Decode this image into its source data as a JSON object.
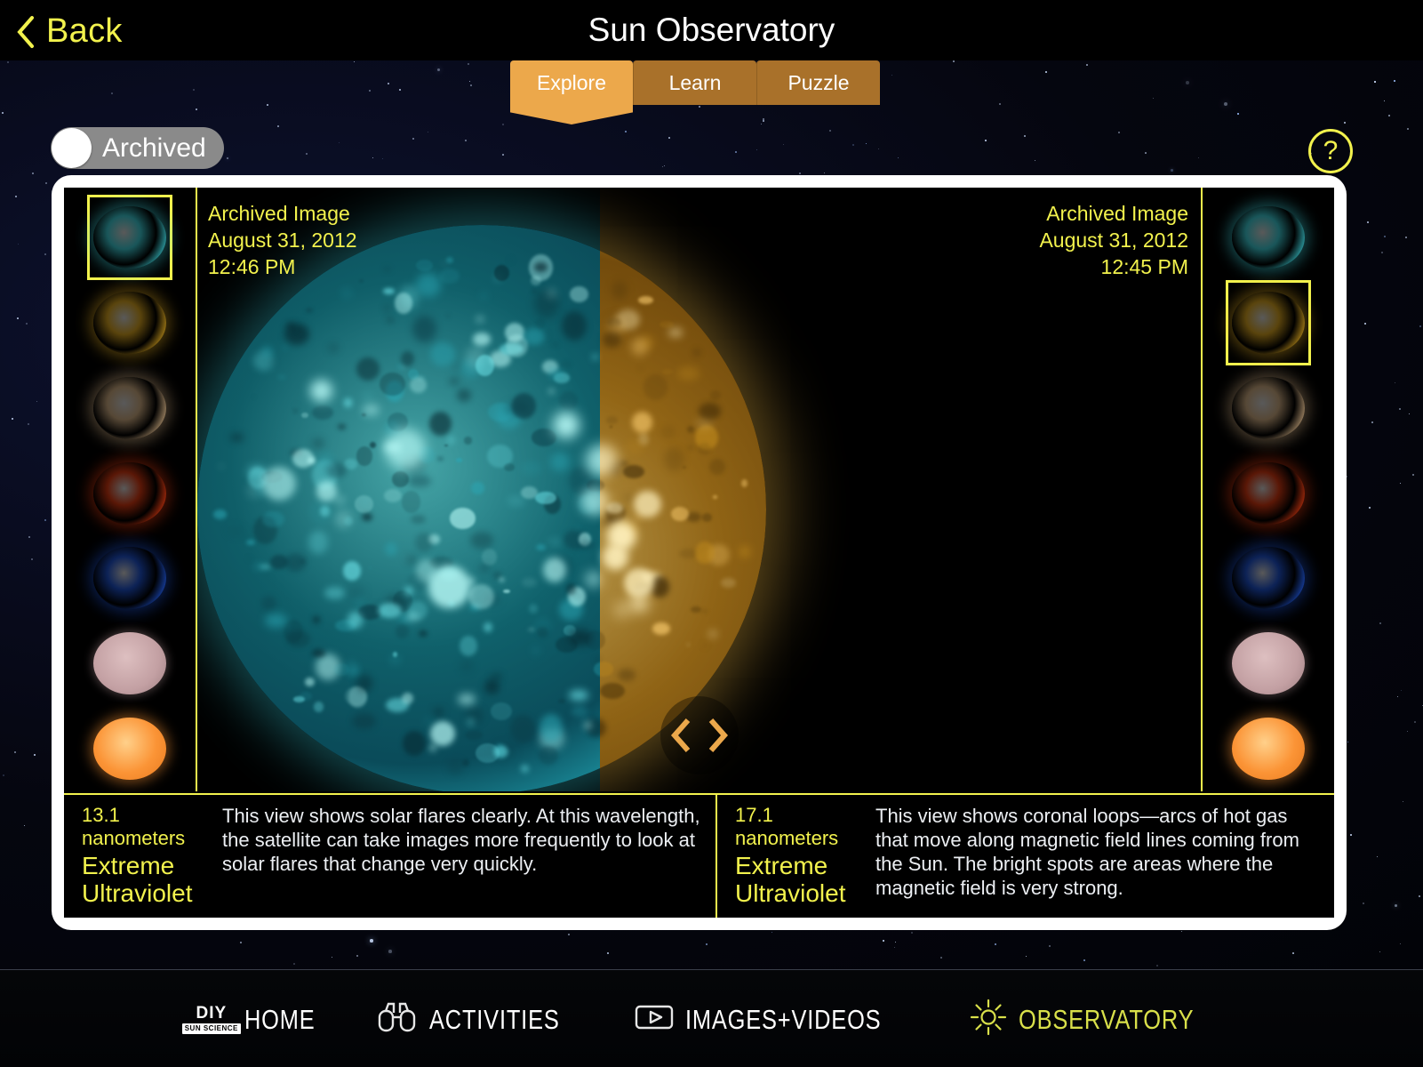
{
  "header": {
    "back_label": "Back",
    "back_icon": "chevron-left-icon",
    "title": "Sun Observatory"
  },
  "tabs": [
    {
      "label": "Explore",
      "active": true
    },
    {
      "label": "Learn",
      "active": false
    },
    {
      "label": "Puzzle",
      "active": false
    }
  ],
  "toggle": {
    "label": "Archived",
    "state": "off"
  },
  "help": {
    "label": "?",
    "icon": "question-mark-icon"
  },
  "viewer": {
    "left": {
      "meta_line1": "Archived Image",
      "meta_line2": "August 31, 2012",
      "meta_line3": "12:46 PM"
    },
    "right": {
      "meta_line1": "Archived Image",
      "meta_line2": "August 31, 2012",
      "meta_line3": "12:45 PM"
    },
    "prev_icon": "chevron-left-icon",
    "next_icon": "chevron-right-icon"
  },
  "thumbnails_left": [
    {
      "name": "thumb-extreme-ultraviolet-131",
      "color": "#3fd8e0",
      "selected": true
    },
    {
      "name": "thumb-extreme-ultraviolet-171",
      "color": "#e0aa20",
      "selected": false
    },
    {
      "name": "thumb-extreme-ultraviolet-193",
      "color": "#d8b487",
      "selected": false
    },
    {
      "name": "thumb-extreme-ultraviolet-304",
      "color": "#e03a10",
      "selected": false
    },
    {
      "name": "thumb-extreme-ultraviolet-335",
      "color": "#1f55d8",
      "selected": false
    },
    {
      "name": "thumb-hydrogen-alpha",
      "color": "#c3a0a3",
      "selected": false
    },
    {
      "name": "thumb-visible-light",
      "color": "#fb9436",
      "selected": false
    }
  ],
  "thumbnails_right": [
    {
      "name": "thumb-extreme-ultraviolet-131",
      "color": "#3fd8e0",
      "selected": false
    },
    {
      "name": "thumb-extreme-ultraviolet-171",
      "color": "#e0aa20",
      "selected": true
    },
    {
      "name": "thumb-extreme-ultraviolet-193",
      "color": "#d8b487",
      "selected": false
    },
    {
      "name": "thumb-extreme-ultraviolet-304",
      "color": "#e03a10",
      "selected": false
    },
    {
      "name": "thumb-extreme-ultraviolet-335",
      "color": "#1f55d8",
      "selected": false
    },
    {
      "name": "thumb-hydrogen-alpha",
      "color": "#c3a0a3",
      "selected": false
    },
    {
      "name": "thumb-visible-light",
      "color": "#fb9436",
      "selected": false
    }
  ],
  "captions": {
    "left": {
      "wavelength": "13.1 nanometers",
      "name": "Extreme Ultraviolet",
      "description": "This view shows solar flares clearly. At this wavelength, the satellite can take images more frequently to look at solar flares that change very quickly."
    },
    "right": {
      "wavelength": "17.1 nanometers",
      "name": "Extreme Ultraviolet",
      "description": "This view shows coronal loops—arcs of hot gas that move along magnetic field lines coming from the Sun. The bright spots are areas where the magnetic field is very strong."
    }
  },
  "bottom_nav": [
    {
      "label": "HOME",
      "icon": "diy-sun-science-logo",
      "active": false
    },
    {
      "label": "ACTIVITIES",
      "icon": "binoculars-icon",
      "active": false
    },
    {
      "label": "IMAGES+VIDEOS",
      "icon": "video-play-icon",
      "active": false
    },
    {
      "label": "OBSERVATORY",
      "icon": "sun-icon",
      "active": true
    }
  ],
  "bottom_nav_logo": {
    "top": "DIY",
    "bottom": "SUN SCIENCE"
  },
  "colors": {
    "accent_yellow": "#f2f24d",
    "tab_active": "#eca84b",
    "tab_inactive": "#a9712a",
    "observatory_highlight": "#d9e04a",
    "frame": "#ffffff"
  }
}
